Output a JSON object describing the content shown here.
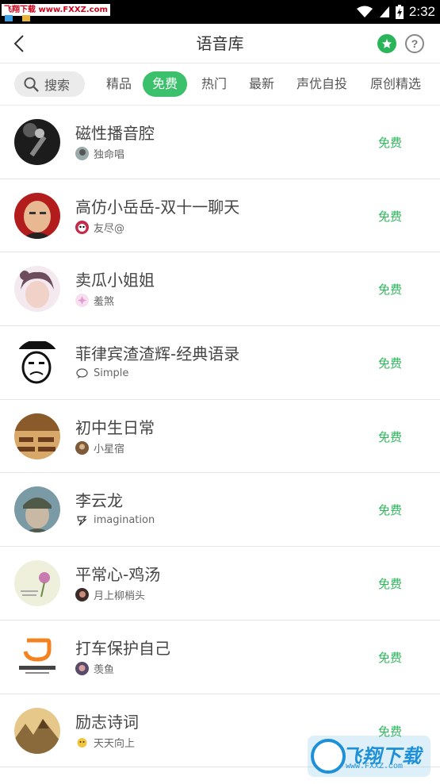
{
  "status_bar": {
    "watermark": "飞翔下载 www.FXXZ.com",
    "time": "2:32"
  },
  "header": {
    "title": "语音库",
    "help_label": "?"
  },
  "filters": {
    "search_label": "搜索",
    "tabs": [
      {
        "label": "精品",
        "active": false
      },
      {
        "label": "免费",
        "active": true
      },
      {
        "label": "热门",
        "active": false
      },
      {
        "label": "最新",
        "active": false
      },
      {
        "label": "声优自投",
        "active": false
      },
      {
        "label": "原创精选",
        "active": false
      }
    ]
  },
  "items": [
    {
      "title": "磁性播音腔",
      "author": "独命唱",
      "price": "免费"
    },
    {
      "title": "高仿小岳岳-双十一聊天",
      "author": "友尽@",
      "price": "免费"
    },
    {
      "title": "卖瓜小姐姐",
      "author": "羞煞",
      "price": "免费"
    },
    {
      "title": "菲律宾渣渣辉-经典语录",
      "author": "Simple",
      "price": "免费"
    },
    {
      "title": "初中生日常",
      "author": "小星宿",
      "price": "免费"
    },
    {
      "title": "李云龙",
      "author": "imagination",
      "price": "免费"
    },
    {
      "title": "平常心-鸡汤",
      "author": "月上柳梢头",
      "price": "免费"
    },
    {
      "title": "打车保护自己",
      "author": "羡鱼",
      "price": "免费"
    },
    {
      "title": "励志诗词",
      "author": "天天向上",
      "price": "免费"
    }
  ],
  "watermark_bottom": {
    "text": "飞翔下载",
    "url": "www.FXXZ.com"
  },
  "colors": {
    "accent": "#3bc06b",
    "price": "#2eb85c",
    "status_bar": "#000000"
  }
}
